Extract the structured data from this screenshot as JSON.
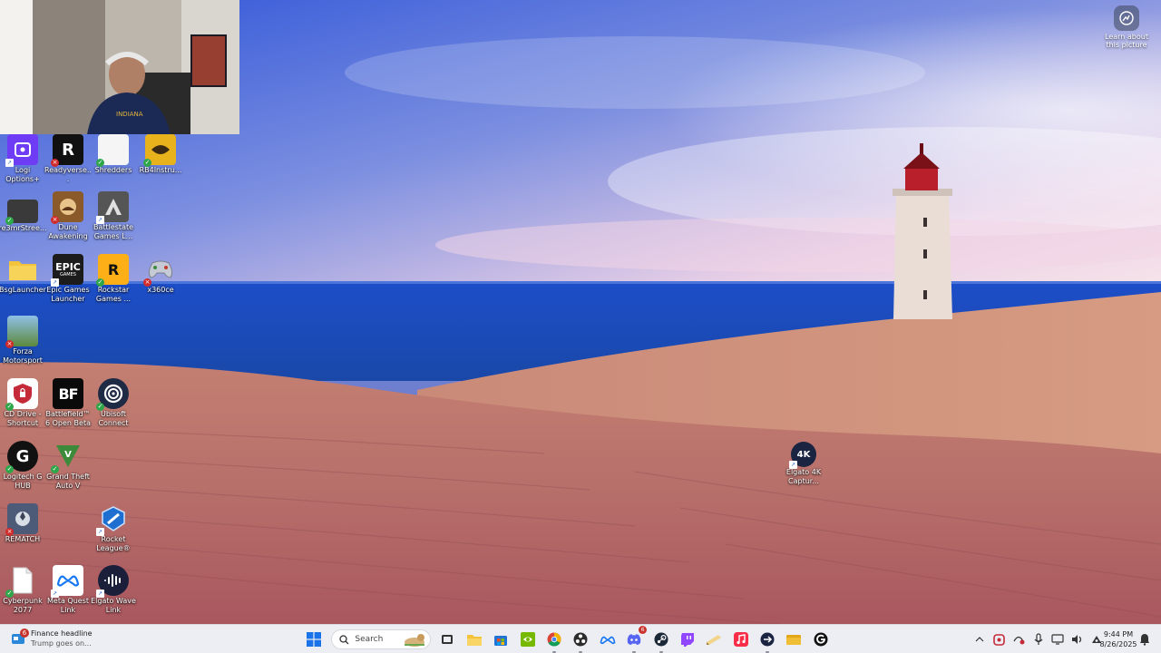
{
  "screen": {
    "title": "Windows desktop"
  },
  "learn_picture": {
    "label": "Learn about this picture",
    "icon": "camera-icon"
  },
  "desktop_icons": [
    {
      "name": "logi-options",
      "label": "Logi Options+",
      "icon": "logi-options-icon",
      "color": "#6f3cf5"
    },
    {
      "name": "readyverse",
      "label": "Readyverse...",
      "icon": "readyverse-icon",
      "color": "#111111"
    },
    {
      "name": "shredders",
      "label": "Shredders",
      "icon": "shredders-icon",
      "color": "#f5f5f5"
    },
    {
      "name": "rb4instruments",
      "label": "RB4Instru...",
      "icon": "rb4-icon",
      "color": "#e8b21c"
    },
    {
      "name": "re3mrstreet",
      "label": "re3mrStree...",
      "icon": "re3mr-icon",
      "color": "#3a3a3a"
    },
    {
      "name": "dune-awakening",
      "label": "Dune Awakening",
      "icon": "dune-icon",
      "color": "#8a5a2a"
    },
    {
      "name": "battlestate-games",
      "label": "Battlestate Games L...",
      "icon": "battlestate-icon",
      "color": "#555555"
    },
    {
      "name": "bsglauncher",
      "label": "BsgLauncher",
      "icon": "folder-icon",
      "color": "#f3c33c"
    },
    {
      "name": "epic-games",
      "label": "Epic Games Launcher",
      "icon": "epic-games-icon",
      "color": "#1c1c1c"
    },
    {
      "name": "rockstar-games",
      "label": "Rockstar Games ...",
      "icon": "rockstar-icon",
      "color": "#fcaf17"
    },
    {
      "name": "x360ce",
      "label": "x360ce",
      "icon": "gamepad-icon",
      "color": "#9aa3b4"
    },
    {
      "name": "forza-motorsport",
      "label": "Forza Motorsport",
      "icon": "forza-icon",
      "color": "#5d8a3c"
    },
    {
      "name": "cd-drive",
      "label": "CD Drive - Shortcut",
      "icon": "cd-drive-icon",
      "color": "#c42a38"
    },
    {
      "name": "battlefield-6",
      "label": "Battlefield™ 6 Open Beta",
      "icon": "battlefield-icon",
      "color": "#0a0a0a"
    },
    {
      "name": "ubisoft-connect",
      "label": "Ubisoft Connect",
      "icon": "ubisoft-icon",
      "color": "#1f2a44"
    },
    {
      "name": "logitech-ghub",
      "label": "Logitech G HUB",
      "icon": "logitech-g-icon",
      "color": "#111111"
    },
    {
      "name": "gta-v",
      "label": "Grand Theft Auto V",
      "icon": "gta-icon",
      "color": "#3c8a3a"
    },
    {
      "name": "rematch",
      "label": "REMATCH",
      "icon": "rematch-icon",
      "color": "#4d5a78"
    },
    {
      "name": "rocket-league",
      "label": "Rocket League®",
      "icon": "rocket-league-icon",
      "color": "#1f6fd1"
    },
    {
      "name": "cyberpunk-2077",
      "label": "Cyberpunk 2077",
      "icon": "document-icon",
      "color": "#ffffff"
    },
    {
      "name": "meta-quest-link",
      "label": "Meta Quest Link",
      "icon": "meta-icon",
      "color": "#ffffff"
    },
    {
      "name": "elgato-wave-link",
      "label": "Elgato Wave Link",
      "icon": "wave-link-icon",
      "color": "#1b1f3a"
    },
    {
      "name": "elgato-4k-capture",
      "label": "Elgato 4K Captur...",
      "icon": "elgato-4k-icon",
      "color": "#1b2440"
    }
  ],
  "taskbar": {
    "news": {
      "title": "Finance headline",
      "subtitle": "Trump goes on...",
      "badge": "6"
    },
    "search": {
      "placeholder": "Search"
    },
    "pinned": [
      {
        "name": "start",
        "icon": "windows-logo-icon"
      },
      {
        "name": "task-view",
        "icon": "task-view-icon"
      },
      {
        "name": "file-explorer",
        "icon": "folder-icon"
      },
      {
        "name": "microsoft-store",
        "icon": "store-icon"
      },
      {
        "name": "nvidia",
        "icon": "nvidia-icon"
      },
      {
        "name": "chrome",
        "icon": "chrome-icon"
      },
      {
        "name": "obs",
        "icon": "obs-icon"
      },
      {
        "name": "meta-quest-link",
        "icon": "meta-icon"
      },
      {
        "name": "discord",
        "icon": "discord-icon",
        "badge": "6"
      },
      {
        "name": "steam",
        "icon": "steam-icon"
      },
      {
        "name": "twitch",
        "icon": "twitch-icon"
      },
      {
        "name": "notes",
        "icon": "notes-icon"
      },
      {
        "name": "music",
        "icon": "music-icon"
      },
      {
        "name": "elgato-stream",
        "icon": "elgato-icon"
      },
      {
        "name": "folder-manager",
        "icon": "yellow-folder-icon"
      },
      {
        "name": "logitech-ghub",
        "icon": "logitech-g-icon"
      }
    ],
    "tray": [
      "chevron-up-icon",
      "copilot-icon",
      "network-shield-icon",
      "microphone-icon",
      "display-icon",
      "speaker-icon",
      "settings-tray-icon"
    ],
    "clock": {
      "time": "9:44 PM",
      "date": "8/26/2025"
    }
  }
}
